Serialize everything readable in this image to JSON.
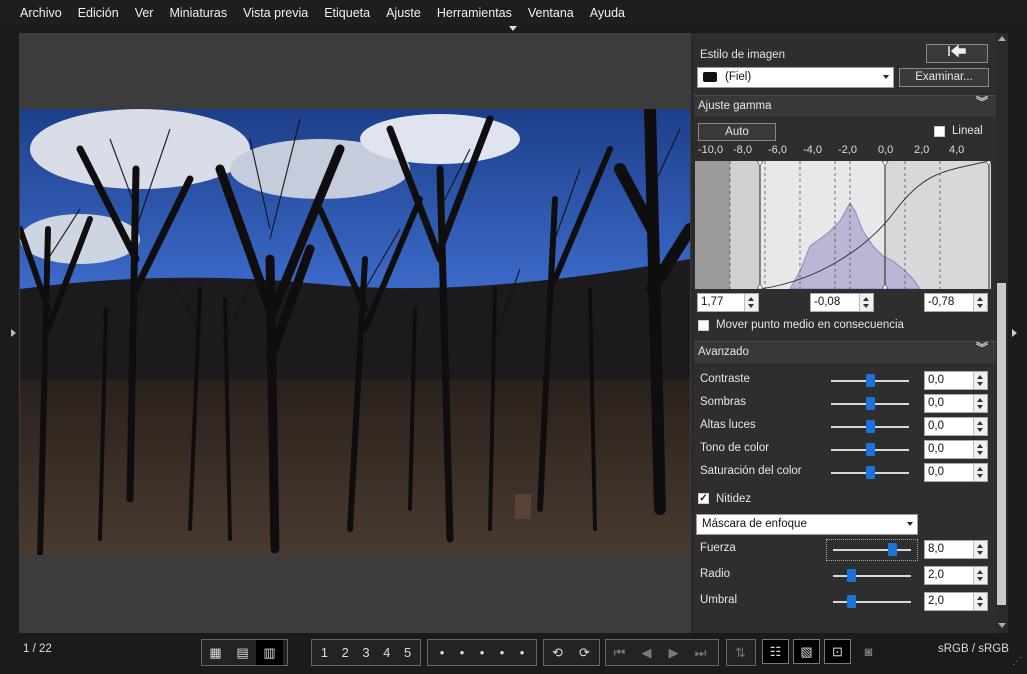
{
  "menu": [
    "Archivo",
    "Edición",
    "Ver",
    "Miniaturas",
    "Vista previa",
    "Etiqueta",
    "Ajuste",
    "Herramientas",
    "Ventana",
    "Ayuda"
  ],
  "status": {
    "counter": "1 / 22",
    "color_space": "sRGB / sRGB"
  },
  "picture_style": {
    "label": "Estilo de imagen",
    "value": "(Fiel)",
    "browse": "Examinar..."
  },
  "gamma": {
    "title": "Ajuste gamma",
    "auto": "Auto",
    "linear": "Lineal",
    "linear_checked": false,
    "scale": [
      "-10,0",
      "-8,0",
      "-6,0",
      "-4,0",
      "-2,0",
      "0,0",
      "2,0",
      "4,0"
    ],
    "black": "1,77",
    "mid": "-0,08",
    "white": "-0,78",
    "move_mid": "Mover punto medio en consecuencia",
    "move_mid_checked": false
  },
  "advanced": {
    "title": "Avanzado",
    "rows": [
      {
        "label": "Contraste",
        "value": "0,0",
        "level": 0.5
      },
      {
        "label": "Sombras",
        "value": "0,0",
        "level": 0.5
      },
      {
        "label": "Altas luces",
        "value": "0,0",
        "level": 0.5
      },
      {
        "label": "Tono de color",
        "value": "0,0",
        "level": 0.5
      },
      {
        "label": "Saturación del color",
        "value": "0,0",
        "level": 0.5
      }
    ],
    "sharpness_label": "Nitidez",
    "sharpness_checked": true,
    "mode": "Máscara de enfoque",
    "sharp_rows": [
      {
        "label": "Fuerza",
        "value": "8,0",
        "level": 0.8
      },
      {
        "label": "Radio",
        "value": "2,0",
        "level": 0.2
      },
      {
        "label": "Umbral",
        "value": "2,0",
        "level": 0.2
      }
    ]
  },
  "toolbar": {
    "ratings": [
      "1",
      "2",
      "3",
      "4",
      "5"
    ],
    "glyph_check": "✓"
  },
  "colors": {
    "accent": "#1a73d8",
    "panel": "#2e2e2e",
    "viewer": "#3c3c3c"
  }
}
